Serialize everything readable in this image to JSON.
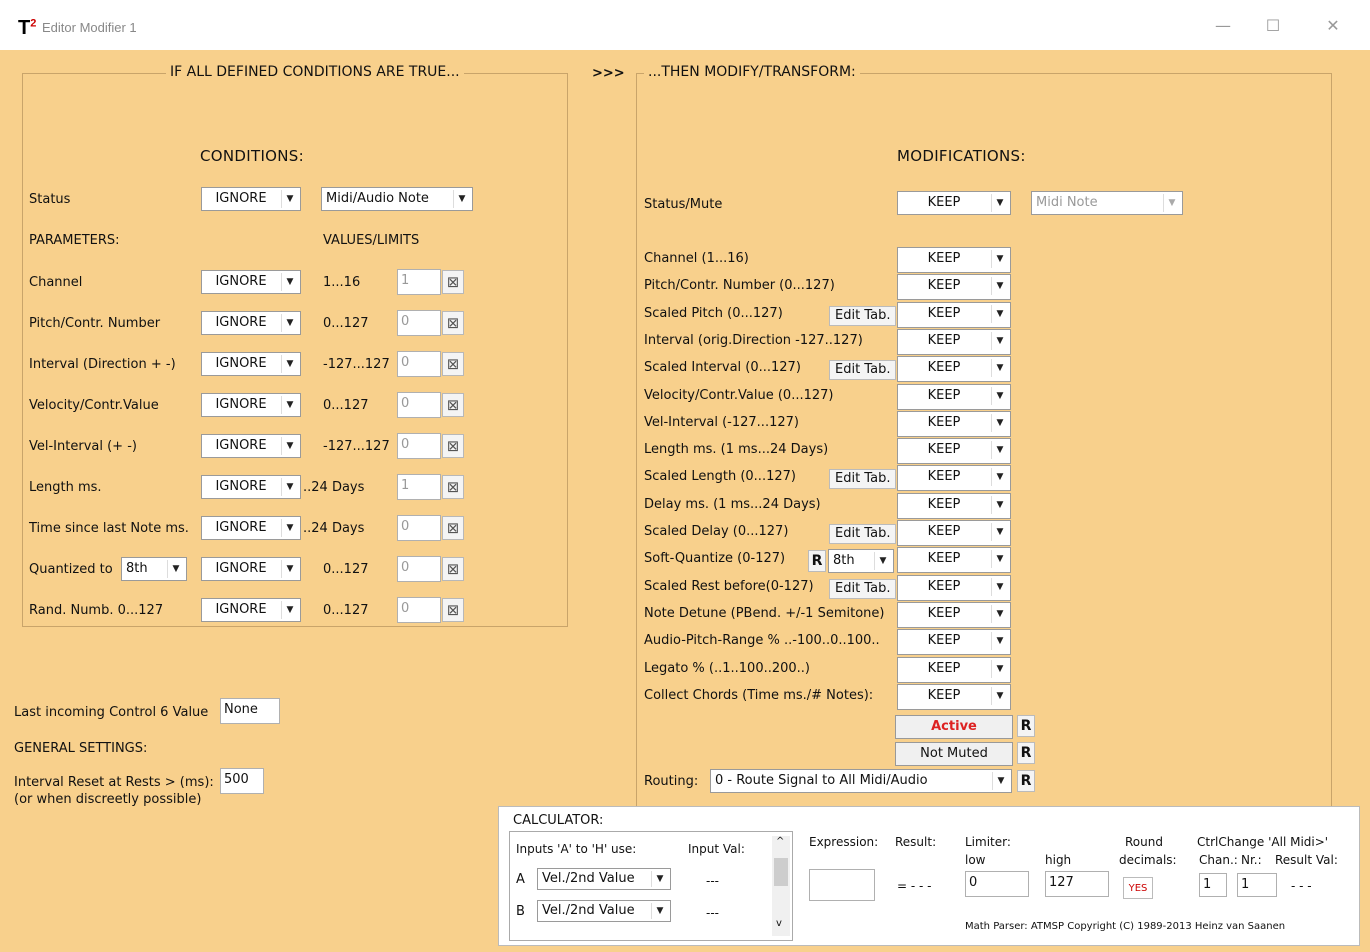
{
  "window": {
    "logo": "T",
    "logo_sup": "2",
    "title": "Editor Modifier 1",
    "minimize": "—",
    "maximize": "☐",
    "close": "✕"
  },
  "left": {
    "group_title": "IF ALL DEFINED CONDITIONS ARE TRUE...",
    "header": "CONDITIONS:",
    "status_label": "Status",
    "status_value": "IGNORE",
    "status_type": "Midi/Audio Note",
    "parameters_label": "PARAMETERS:",
    "values_label": "VALUES/LIMITS",
    "rows": [
      {
        "label": "Channel",
        "value": "IGNORE",
        "range": "1...16",
        "input": "1"
      },
      {
        "label": "Pitch/Contr. Number",
        "value": "IGNORE",
        "range": "0...127",
        "input": "0"
      },
      {
        "label": "Interval (Direction + -)",
        "value": "IGNORE",
        "range": "-127...127",
        "input": "0"
      },
      {
        "label": "Velocity/Contr.Value",
        "value": "IGNORE",
        "range": "0...127",
        "input": "0"
      },
      {
        "label": "Vel-Interval (+ -)",
        "value": "IGNORE",
        "range": "-127...127",
        "input": "0"
      },
      {
        "label": "Length ms.",
        "value": "IGNORE",
        "range": "..24 Days",
        "input": "1"
      },
      {
        "label": "Time since last Note ms.",
        "value": "IGNORE",
        "range": "..24 Days",
        "input": "0"
      },
      {
        "label": "Quantized to",
        "value": "IGNORE",
        "range": "0...127",
        "input": "0",
        "extra": "8th"
      },
      {
        "label": "Rand. Numb. 0...127",
        "value": "IGNORE",
        "range": "0...127",
        "input": "0"
      }
    ]
  },
  "arrows": ">>>",
  "right": {
    "group_title": "...THEN MODIFY/TRANSFORM:",
    "header": "MODIFICATIONS:",
    "status_label": "Status/Mute",
    "status_value": "KEEP",
    "status_type": "Midi Note",
    "edit_label": "Edit Tab.",
    "rows": [
      {
        "label": "Channel (1...16)",
        "value": "KEEP"
      },
      {
        "label": "Pitch/Contr. Number (0...127)",
        "value": "KEEP"
      },
      {
        "label": "Scaled Pitch (0...127)",
        "value": "KEEP",
        "edit": true
      },
      {
        "label": "Interval (orig.Direction -127..127)",
        "value": "KEEP"
      },
      {
        "label": "Scaled Interval (0...127)",
        "value": "KEEP",
        "edit": true
      },
      {
        "label": "Velocity/Contr.Value (0...127)",
        "value": "KEEP"
      },
      {
        "label": "Vel-Interval (-127...127)",
        "value": "KEEP"
      },
      {
        "label": "Length ms. (1 ms...24 Days)",
        "value": "KEEP"
      },
      {
        "label": "Scaled Length (0...127)",
        "value": "KEEP",
        "edit": true
      },
      {
        "label": "Delay ms. (1 ms...24 Days)",
        "value": "KEEP"
      },
      {
        "label": "Scaled Delay (0...127)",
        "value": "KEEP",
        "edit": true
      },
      {
        "label": "Soft-Quantize (0-127)",
        "value": "KEEP",
        "quant": "8th"
      },
      {
        "label": "Scaled Rest before(0-127)",
        "value": "KEEP",
        "edit": true
      },
      {
        "label": "Note Detune (PBend. +/-1 Semitone)",
        "value": "KEEP"
      },
      {
        "label": "Audio-Pitch-Range % ..-100..0..100..",
        "value": "KEEP"
      },
      {
        "label": "Legato % (..1..100..200..)",
        "value": "KEEP"
      },
      {
        "label": "Collect Chords (Time ms./# Notes):",
        "value": "KEEP"
      }
    ],
    "active_label": "Active",
    "muted_label": "Not Muted",
    "routing_label": "Routing:",
    "routing_value": "0 - Route Signal to All Midi/Audio",
    "r_glyph": "R"
  },
  "bottom_left": {
    "last_control_label": "Last incoming Control 6 Value",
    "last_control_value": "None",
    "general_label": "GENERAL SETTINGS:",
    "interval_reset_label": "Interval Reset at Rests > (ms):",
    "interval_reset_value": "500",
    "interval_reset_note": "(or when discreetly possible)"
  },
  "calculator": {
    "title": "CALCULATOR:",
    "inputs_label": "Inputs 'A' to 'H' use:",
    "input_val_label": "Input Val:",
    "rows": [
      {
        "letter": "A",
        "source": "Vel./2nd Value",
        "value": "---"
      },
      {
        "letter": "B",
        "source": "Vel./2nd Value",
        "value": "---"
      }
    ],
    "expression_label": "Expression:",
    "result_label": "Result:",
    "result_value": "= - - -",
    "limiter_label": "Limiter:",
    "low_label": "low",
    "high_label": "high",
    "low_value": "0",
    "high_value": "127",
    "round_label": "Round",
    "decimals_label": "decimals:",
    "round_value": "YES",
    "ctrl_label": "CtrlChange 'All Midi>'",
    "chan_label": "Chan.:",
    "nr_label": "Nr.:",
    "result_val_label": "Result Val:",
    "chan_value": "1",
    "nr_value": "1",
    "ctrl_result": "- - -",
    "copyright": "Math Parser: ATMSP Copyright (C) 1989-2013 Heinz van Saanen"
  }
}
